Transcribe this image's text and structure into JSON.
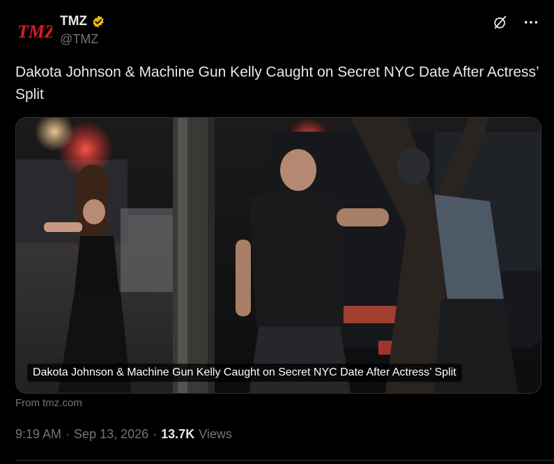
{
  "author": {
    "display_name": "TMZ",
    "handle": "@TMZ",
    "avatar_logo_text": "TMZ",
    "verified_badge_color": "#e8b416"
  },
  "top_actions": {
    "grok_icon": "grok-icon",
    "more_icon": "more-options-icon"
  },
  "tweet": {
    "text": "Dakota Johnson & Machine Gun Kelly Caught on Secret NYC Date After Actress’ Split"
  },
  "media": {
    "caption": "Dakota Johnson & Machine Gun Kelly Caught on Secret NYC Date After Actress’ Split"
  },
  "source": {
    "label": "From tmz.com"
  },
  "meta": {
    "time": "9:19 AM",
    "separator": "·",
    "date": "Sep 13, 2026",
    "views_count": "13.7K",
    "views_label": "Views"
  },
  "colors": {
    "background": "#000000",
    "primary_text": "#e7e9ea",
    "secondary_text": "#71767b",
    "border": "#2f3336",
    "brand_red": "#d7202a"
  }
}
